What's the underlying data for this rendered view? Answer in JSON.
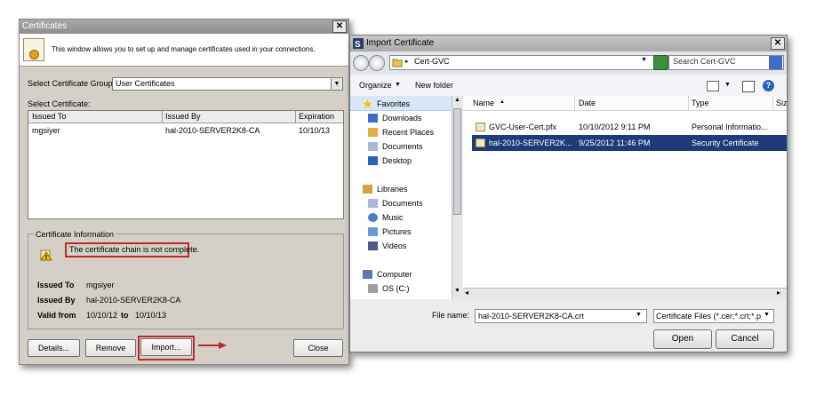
{
  "certificates": {
    "title": "Certificates",
    "close_glyph": "✕",
    "info_text": "This window allows you to set up and manage certificates used in your connections.",
    "group_label": "Select Certificate Group:",
    "group_value": "User Certificates",
    "select_label": "Select Certificate:",
    "columns": [
      "Issued To",
      "Issued By",
      "Expiration"
    ],
    "rows": [
      {
        "issued_to": "mgsiyer",
        "issued_by": "hal-2010-SERVER2K8-CA",
        "expiration": "10/10/13"
      }
    ],
    "cert_info": {
      "heading": "Certificate Information",
      "warning": "The certificate chain is not complete.",
      "issued_to_label": "Issued To",
      "issued_to_value": "mgsiyer",
      "issued_by_label": "Issued By",
      "issued_by_value": "hal-2010-SERVER2K8-CA",
      "valid_from_label": "Valid from",
      "valid_from_value": "10/10/12",
      "to_label": "to",
      "valid_to_value": "10/10/13"
    },
    "buttons": {
      "details": "Details...",
      "remove": "Remove",
      "import": "Import...",
      "close": "Close"
    }
  },
  "import_dialog": {
    "title": "Import Certificate",
    "close_glyph": "✕",
    "address": "Cert-GVC",
    "address_chevron": "▸",
    "search_placeholder": "Search Cert-GVC",
    "toolbar": {
      "organize": "Organize",
      "organize_arrow": "▼",
      "new_folder": "New folder"
    },
    "nav": {
      "favorites": "Favorites",
      "downloads": "Downloads",
      "recent_places": "Recent Places",
      "documents": "Documents",
      "desktop": "Desktop",
      "libraries": "Libraries",
      "lib_documents": "Documents",
      "music": "Music",
      "pictures": "Pictures",
      "videos": "Videos",
      "computer": "Computer",
      "os_drive": "OS (C:)"
    },
    "columns": {
      "name": "Name",
      "date": "Date",
      "type": "Type",
      "size": "Siz"
    },
    "files": [
      {
        "name": "GVC-User-Cert.pfx",
        "date": "10/10/2012 9:11 PM",
        "type": "Personal Informatio..."
      },
      {
        "name": "hal-2010-SERVER2K...",
        "date": "9/25/2012 11:46 PM",
        "type": "Security Certificate"
      }
    ],
    "file_name_label": "File name:",
    "file_name_value": "hal-2010-SERVER2K8-CA.crt",
    "file_type_value": "Certificate Files (*.cer;*.crt;*.p",
    "open": "Open",
    "cancel": "Cancel"
  },
  "colors": {
    "accent_red": "#c0262c",
    "selection": "#1d3b79"
  }
}
